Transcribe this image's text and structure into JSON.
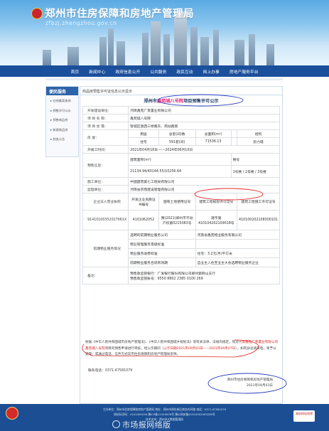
{
  "header": {
    "title": "郑州市住房保障和房地产管理局",
    "url": "zfbzj.zhengzhou.gov.cn"
  },
  "nav": [
    "首页",
    "新闻中心",
    "政府信息公开",
    "公共服务",
    "政民互动",
    "网上办事",
    "房地产服务平台"
  ],
  "sidebar": {
    "heading": "便民服务",
    "items": [
      "在线备案查询",
      "预售许可公示",
      "预售商品房",
      "新建商品房",
      "拍卖公告"
    ]
  },
  "breadcrumb": "商品房预售许可证信息公示显示",
  "document": {
    "title_prefix": "郑州市",
    "title_highlight": "鑫苑城八号院",
    "title_suffix": "项目预售许可公示"
  },
  "info": {
    "developer_label": "开发建设单位：",
    "developer": "河南鑫苑广景置业有限公司",
    "project_name_label": "项 目 名 称：",
    "project_name": "鑫苑城八号院",
    "location_label": "项 目 坐 落：",
    "location": "管城区陇西三桥路东、南站路南",
    "house_label": "房  屋：",
    "house_headers": [
      "用途",
      "总套(间)数",
      "总面积(m²)",
      "",
      "结构"
    ],
    "house_values": [
      "住宅",
      "591套(间)",
      "71536.13",
      "",
      "剪力墙"
    ],
    "period_label": "开竣工时间：",
    "period": "2021年04月18日------2024年06月10日",
    "presale_label": "预售信息：",
    "area_label": "建筑面积(m²)",
    "building_label": "楼号",
    "area_value": "21134.94/40144.55/10256.64",
    "buildings_value": "1号楼 / 2号楼 / 3号楼",
    "construction_label": "施工单位：",
    "construction": "中国建筑第七工程局有限公司",
    "supervision_label": "监理单位：",
    "supervision": "河南省宗鼎建设管理有限公司",
    "license_label": "企业法人营业执照",
    "license_headers": [
      "开发企业资质证书编号",
      "国有土地使用证号",
      "建筑工程规划许可证号",
      "建筑工程施工许可证号"
    ],
    "license_code": "91410100352027661X",
    "license_values": [
      "4101062052",
      "豫(2021)郑州市不动产权第0215083号",
      "建字第410104202109018号",
      "410100202108300101"
    ],
    "property_label": "前期物业服务情况",
    "property_rows": [
      {
        "left": "选聘的前期物业服务公司",
        "right": "河南省鑫苑物业服务有限公司"
      },
      {
        "left": "物业管理服务等级标准",
        "right": ""
      },
      {
        "left": "物业服务收费标准",
        "right": "住宅：3.2元/月/平方米"
      },
      {
        "left": "前期物业服务合同有效期",
        "right": "自业主入住至业主大会选聘物业服务企业"
      }
    ],
    "remark_label": "备注：",
    "remark_lines": [
      "预售款监管银行：广发银行股份有限公司郑州紫荆山支行",
      "预售款监管账号：9550 8802 2385 0100 269"
    ]
  },
  "notice": {
    "p1": "依据《中华人民共和国城市房地产管理法》、《中华人民共和国城乡规划法》等有关法律、法规的规定，现对",
    "p2_red": "河南鑫苑广景置业有限公司鑫苑城八号院",
    "p2": "项目的预售申请进行审核，经公示期间（",
    "p2_red2": "公示日期2021年09月03日-----2021年09月07日",
    "p3": "），如有异议请来电，将予以受理；或通过电话、信件方式向市住房保障和房地产管理局反映。"
  },
  "contact": "联系电话：0371-67581079",
  "signature": [
    "郑州市住房保障和房地产管理局",
    "2021年09月03日"
  ],
  "footer": {
    "line1": "主办单位：郑州市住房保障和房地产管理局 地址：郑州市郑东新区商务内环路 电话：0371-67581079",
    "line2": "网站标识码：4101000036 豫ICP备12345678号 豫公网安备41010502003289号",
    "line3": "技术支持：郑州市大数据管理局",
    "badge_text": "政府网站找错",
    "watermark": "市场报网络版"
  },
  "colors": {
    "nav": "#1a4f9c",
    "footer": "#1b4e93",
    "highlight": "#e21c6f",
    "annotation_red": "#e32a2a",
    "annotation_blue": "#2a3fbf"
  }
}
